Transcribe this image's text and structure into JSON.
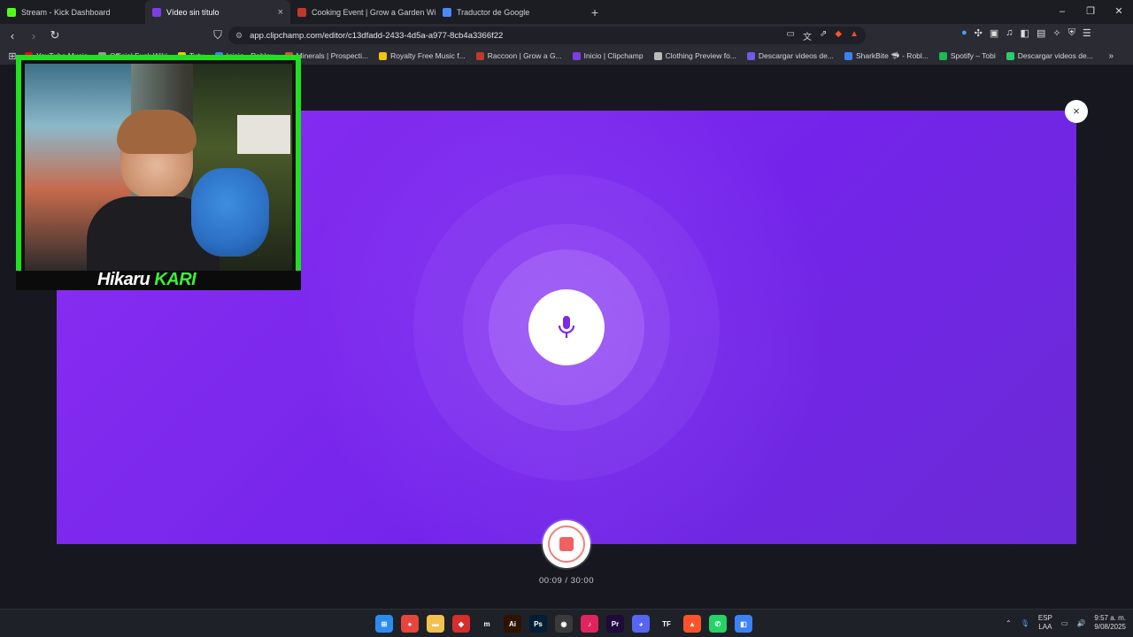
{
  "tabs": [
    {
      "label": "Stream - Kick Dashboard",
      "color": "#53fc18",
      "active": false
    },
    {
      "label": "Vídeo sin título",
      "color": "#7b3fe4",
      "active": true
    },
    {
      "label": "Cooking Event | Grow a Garden Wiki",
      "color": "#c0392b",
      "active": false
    },
    {
      "label": "Traductor de Google",
      "color": "#4a8af4",
      "active": false
    }
  ],
  "tab_close": "×",
  "new_tab": "+",
  "window": {
    "minimize": "–",
    "restore": "❐",
    "close": "✕"
  },
  "address": {
    "url": "app.clipchamp.com/editor/c13dfadd-2433-4d5a-a977-8cb4a3366f22",
    "brave_badge": "1"
  },
  "bookmarks": [
    {
      "label": "YouTube Music",
      "color": "#ff0000"
    },
    {
      "label": "Official Fuck.Wiki",
      "color": "#999999"
    },
    {
      "label": "Tutu",
      "color": "#f1c40f"
    },
    {
      "label": "Inicio - Roblox",
      "color": "#3b82f6"
    },
    {
      "label": "Minerals | Prospecti...",
      "color": "#e74c3c"
    },
    {
      "label": "Royalty Free Music f...",
      "color": "#f1c40f"
    },
    {
      "label": "Raccoon | Grow a G...",
      "color": "#c0392b"
    },
    {
      "label": "Inicio | Clipchamp",
      "color": "#7b3fe4"
    },
    {
      "label": "Clothing Preview fo...",
      "color": "#bbbbbb"
    },
    {
      "label": "Descargar videos de...",
      "color": "#6c5ce7"
    },
    {
      "label": "SharkBite 🦈 - Robl...",
      "color": "#3b82f6"
    },
    {
      "label": "Spotify – Tobi",
      "color": "#1db954"
    },
    {
      "label": "Descargar videos de...",
      "color": "#2ecc71"
    }
  ],
  "recorder": {
    "timer": "00:09 / 30:00",
    "close": "×"
  },
  "webcam": {
    "name_a": "Hikaru ",
    "name_b": "KARI"
  },
  "taskbar": {
    "icons": [
      {
        "name": "windows-start-icon",
        "color": "#2b8cf0",
        "glyph": "⊞"
      },
      {
        "name": "chrome-icon",
        "color": "#e8453c",
        "glyph": "●"
      },
      {
        "name": "file-explorer-icon",
        "color": "#f2c14e",
        "glyph": "▬"
      },
      {
        "name": "app-red-icon",
        "color": "#d62d2d",
        "glyph": "◆"
      },
      {
        "name": "app-m-icon",
        "color": "#1f2128",
        "glyph": "m"
      },
      {
        "name": "illustrator-icon",
        "color": "#2d1300",
        "glyph": "Ai"
      },
      {
        "name": "photoshop-icon",
        "color": "#001e36",
        "glyph": "Ps"
      },
      {
        "name": "obs-icon",
        "color": "#3a3a3a",
        "glyph": "◉"
      },
      {
        "name": "tiktok-icon",
        "color": "#e0245e",
        "glyph": "♪"
      },
      {
        "name": "premiere-icon",
        "color": "#1e0a3c",
        "glyph": "Pr"
      },
      {
        "name": "discord-icon",
        "color": "#5865f2",
        "glyph": "◕"
      },
      {
        "name": "tf-icon",
        "color": "#1f2128",
        "glyph": "TF"
      },
      {
        "name": "brave-icon",
        "color": "#fb542b",
        "glyph": "▲"
      },
      {
        "name": "whatsapp-icon",
        "color": "#25d366",
        "glyph": "✆"
      },
      {
        "name": "roblox-studio-icon",
        "color": "#3b82f6",
        "glyph": "◧"
      }
    ],
    "lang_top": "ESP",
    "lang_bottom": "LAA",
    "time": "9:57 a. m.",
    "date": "9/08/2025"
  }
}
